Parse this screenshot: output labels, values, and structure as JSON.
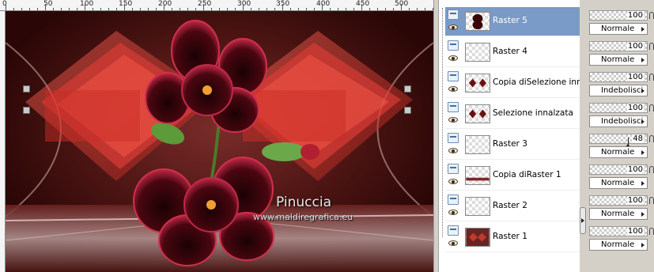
{
  "ruler": {
    "labels": [
      "0",
      "50",
      "100",
      "150",
      "200",
      "250",
      "300",
      "350",
      "400",
      "450",
      "500"
    ]
  },
  "canvas": {
    "watermark_name": "Pinuccia",
    "watermark_url": "www.maldiregrafica.eu",
    "colors": {
      "bg_dark": "#2a0706",
      "bg_mid": "#7a2c2a",
      "diamond": "#e8403a",
      "petal": "#3a0508",
      "petal_edge": "#d0304a"
    }
  },
  "layers": [
    {
      "name": "Raster 5",
      "selected": true,
      "thumb": "flower-thumbnail",
      "opacity": "100",
      "blend": "Normale"
    },
    {
      "name": "Raster 4",
      "selected": false,
      "thumb": "empty-thumbnail",
      "opacity": "100",
      "blend": "Normale"
    },
    {
      "name": "Copia diSelezione innalzata",
      "selected": false,
      "thumb": "diamond-pair-thumbnail",
      "opacity": "100",
      "blend": "Indebolisci"
    },
    {
      "name": "Selezione innalzata",
      "selected": false,
      "thumb": "diamond-pair-thumbnail",
      "opacity": "100",
      "blend": "Indebolisci"
    },
    {
      "name": "Raster 3",
      "selected": false,
      "thumb": "empty-thumbnail",
      "opacity": "48",
      "blend": "Normale"
    },
    {
      "name": "Copia diRaster 1",
      "selected": false,
      "thumb": "stripe-thumbnail",
      "opacity": "100",
      "blend": "Normale"
    },
    {
      "name": "Raster 2",
      "selected": false,
      "thumb": "empty-thumbnail",
      "opacity": "100",
      "blend": "Normale"
    },
    {
      "name": "Raster 1",
      "selected": false,
      "thumb": "background-thumbnail",
      "opacity": "100",
      "blend": "Normale"
    }
  ]
}
